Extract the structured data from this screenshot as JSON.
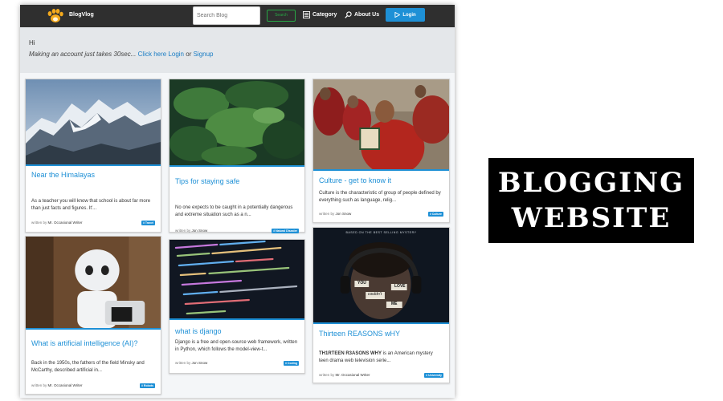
{
  "navbar": {
    "brand": "BlogVlog",
    "logo_icon": "paw-icon",
    "search_placeholder": "Search Blog",
    "search_button": "Search",
    "category_label": "Category",
    "category_icon": "list-icon",
    "about_label": "About Us",
    "about_icon": "search-icon",
    "login_label": "Login",
    "login_icon": "play-icon",
    "login_color": "#1e90d6"
  },
  "jumbotron": {
    "greeting": "Hi",
    "prompt": "Making an account just takes 30sec...",
    "link_text": "Click here Login",
    "or_text": " or ",
    "signup_text": "Signup"
  },
  "cards": [
    {
      "title": "Near the Himalayas",
      "excerpt": "As a teacher you will know that school is about far more than just facts and figures. It'...",
      "author_prefix": "written by ",
      "author": "Mr. Occasional Writer",
      "tag": "# Travel"
    },
    {
      "title": "Tips for staying safe",
      "excerpt": "No one expects to be caught in a potentially dangerous and extreme situation such as a n...",
      "author_prefix": "written by ",
      "author": "Jon Snow",
      "tag": "# Natural Disaster"
    },
    {
      "title": "Culture - get to know it",
      "excerpt": "Culture is the characteristic of group of people defined by everything such as language, relig...",
      "author_prefix": "written by ",
      "author": "Jon Snow",
      "tag": "# Culture"
    },
    {
      "title": "What is artificial intelligence (AI)?",
      "excerpt": "Back in the 1950s, the fathers of the field Minsky and McCarthy, described artificial in...",
      "author_prefix": "written by ",
      "author": "Mr. Occasional Writer",
      "tag": "# Robots"
    },
    {
      "title": "what is django",
      "excerpt": "Django is a free and open-source web framework, written in Python, which follows the model-view-t...",
      "author_prefix": "written by ",
      "author": "Jon Snow",
      "tag": "# Coding"
    },
    {
      "title": "Thirteen REASONS wHY",
      "excerpt_bold": "TH1RTEEN R3ASONS WHY",
      "excerpt": " is an American mystery teen drama web television serie...",
      "author_prefix": "written by ",
      "author": "Mr. Occasional Writer",
      "tag": "# University"
    }
  ],
  "poster": {
    "tagline": "BASED ON THE BEST SELLING MYSTERY",
    "notes": [
      "YOU",
      "couldn't",
      "LOVE",
      "ME"
    ]
  },
  "title_box": {
    "line1": "BLOGGING",
    "line2": "WEBSITE"
  }
}
